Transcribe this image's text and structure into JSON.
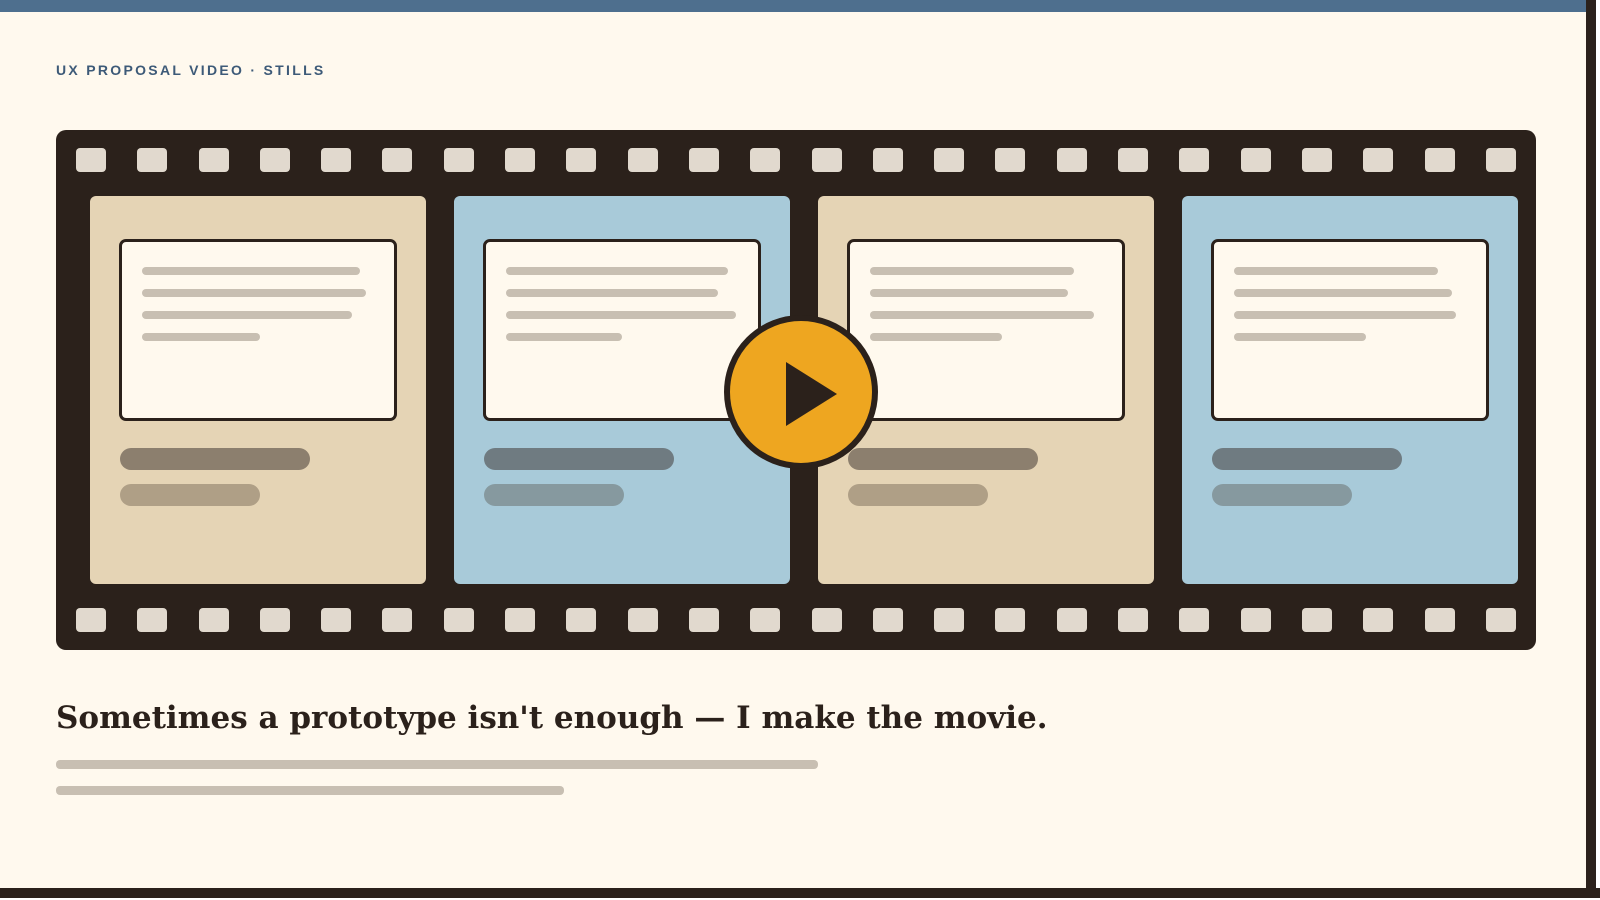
{
  "eyebrow": "UX PROPOSAL VIDEO · STILLS",
  "headline": "Sometimes a prototype isn't enough — I make the movie.",
  "play_button": {
    "icon": "play-icon"
  },
  "colors": {
    "top_bar": "#4e6f8e",
    "background": "#fff9ee",
    "film": "#2b211b",
    "frame_beige": "#e5d4b5",
    "frame_blue": "#a8cad9",
    "play": "#eea620"
  },
  "frames": [
    {
      "tone": "beige"
    },
    {
      "tone": "blue"
    },
    {
      "tone": "beige"
    },
    {
      "tone": "blue"
    }
  ]
}
